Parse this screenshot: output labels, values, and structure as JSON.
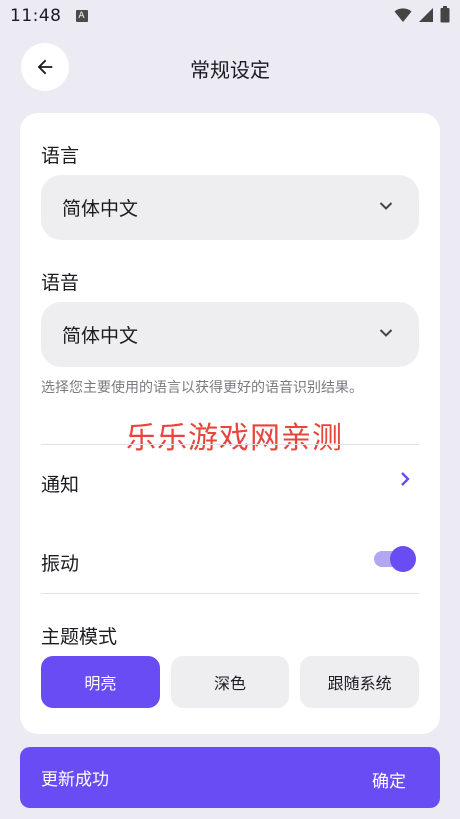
{
  "status_bar": {
    "time": "11:48",
    "a_icon": "A"
  },
  "header": {
    "title": "常规设定"
  },
  "language": {
    "label": "语言",
    "value": "简体中文"
  },
  "voice": {
    "label": "语音",
    "value": "简体中文"
  },
  "helper_text": "选择您主要使用的语言以获得更好的语音识别结果。",
  "watermark": "乐乐游戏网亲测",
  "notifications": {
    "label": "通知"
  },
  "vibration": {
    "label": "振动",
    "enabled": true
  },
  "theme": {
    "label": "主题模式",
    "options": [
      "明亮",
      "深色",
      "跟随系统"
    ],
    "selected": "明亮"
  },
  "snackbar": {
    "message": "更新成功",
    "action": "确定"
  },
  "colors": {
    "accent": "#6A4CF5",
    "accent_light": "#B3A7F2",
    "background": "#ECEAF3",
    "card": "#FFFFFF"
  }
}
